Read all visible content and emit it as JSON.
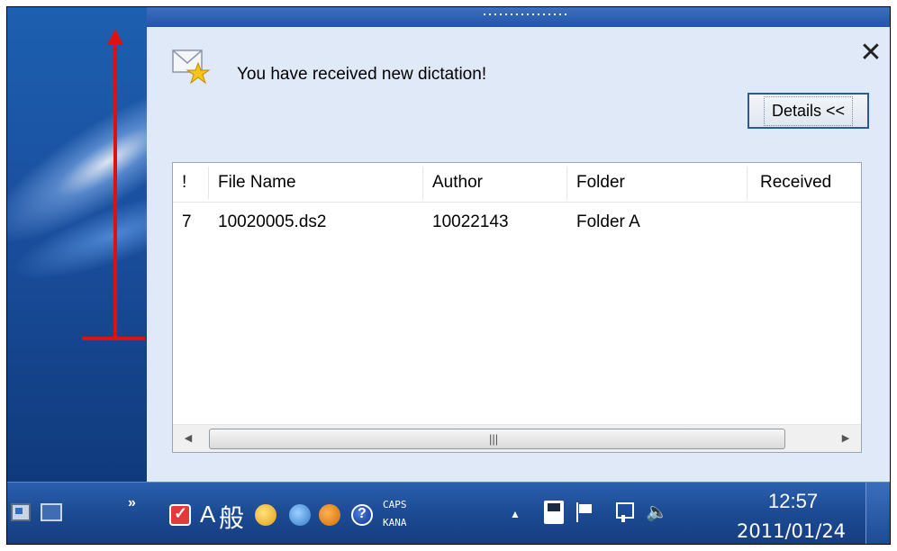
{
  "notification": {
    "message": "You have received new dictation!",
    "close_glyph": "✕",
    "details_label": "Details <<",
    "icons": [
      "envelope-star-icon",
      "close-icon"
    ]
  },
  "file_list": {
    "columns": [
      "!",
      "File Name",
      "Author",
      "Folder",
      "Received"
    ],
    "rows": [
      {
        "priority": "7",
        "file_name": "10020005.ds2",
        "author": "10022143",
        "folder": "Folder A",
        "received": ""
      }
    ],
    "scrollbar": {
      "left_glyph": "◀",
      "right_glyph": "▶",
      "thumb_glyph": "|||"
    }
  },
  "taskbar": {
    "chevron": "»",
    "ime_a": "A",
    "ime_kanji": "般",
    "caps_label": "CAPS",
    "kana_label": "KANA",
    "tray_up": "▲",
    "speaker_glyph": "🔈",
    "time": "12:57",
    "date": "2011/01/24"
  },
  "colors": {
    "annotation_arrow": "#e01010",
    "popup_background": "#dfe9f7",
    "taskbar": "#1b4a92"
  }
}
